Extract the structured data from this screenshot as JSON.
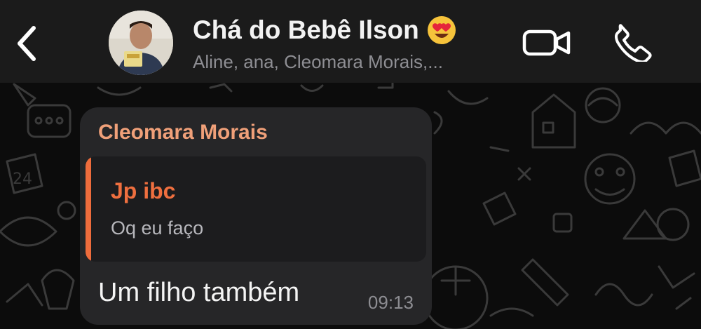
{
  "header": {
    "back_icon": "chevron-left-icon",
    "title": "Chá do Bebê Ilson",
    "title_emoji": "heart-eyes-emoji",
    "subtitle": "Aline, ana, Cleomara Morais,...",
    "video_icon": "video-camera-icon",
    "call_icon": "phone-icon"
  },
  "message": {
    "sender": "Cleomara Morais",
    "quoted": {
      "author": "Jp ibc",
      "text": "Oq eu faço"
    },
    "text": "Um filho também",
    "time": "09:13"
  },
  "colors": {
    "header_bg": "#1b1b1b",
    "bubble_bg": "#262628",
    "sender_name": "#f0a079",
    "quote_accent": "#ee6c3c",
    "icon": "#ffffff"
  }
}
